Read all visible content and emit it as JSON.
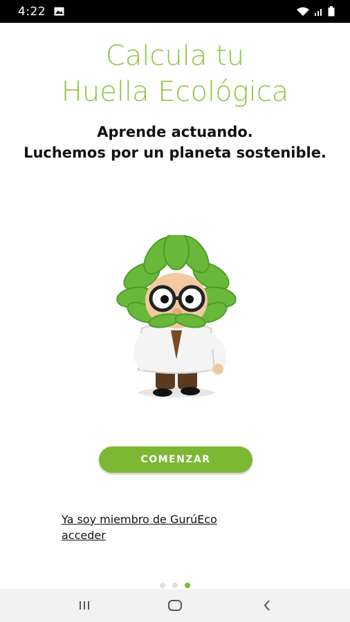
{
  "status_bar": {
    "time": "4:22",
    "icons": [
      "gallery-icon",
      "wifi-icon",
      "signal-icon",
      "battery-icon"
    ]
  },
  "title": {
    "line1": "Calcula tu",
    "line2": "Huella Ecológica"
  },
  "subtitle": {
    "line1": "Aprende actuando.",
    "line2": "Luchemos por un planeta sostenible."
  },
  "mascot": {
    "icon": "eco-guru-mascot"
  },
  "start_button": {
    "label": "COMENZAR"
  },
  "member_link": {
    "line1": "Ya soy miembro de GurúEco",
    "line2": "acceder"
  },
  "pager": {
    "total": 3,
    "active_index": 2
  },
  "nav_bar": {
    "icons": [
      "recent-apps-icon",
      "home-icon",
      "back-icon"
    ]
  },
  "colors": {
    "accent": "#7cb832",
    "title_green": "#8cc63f",
    "status_bar": "#000000",
    "nav_bar": "#f2f2f2"
  }
}
